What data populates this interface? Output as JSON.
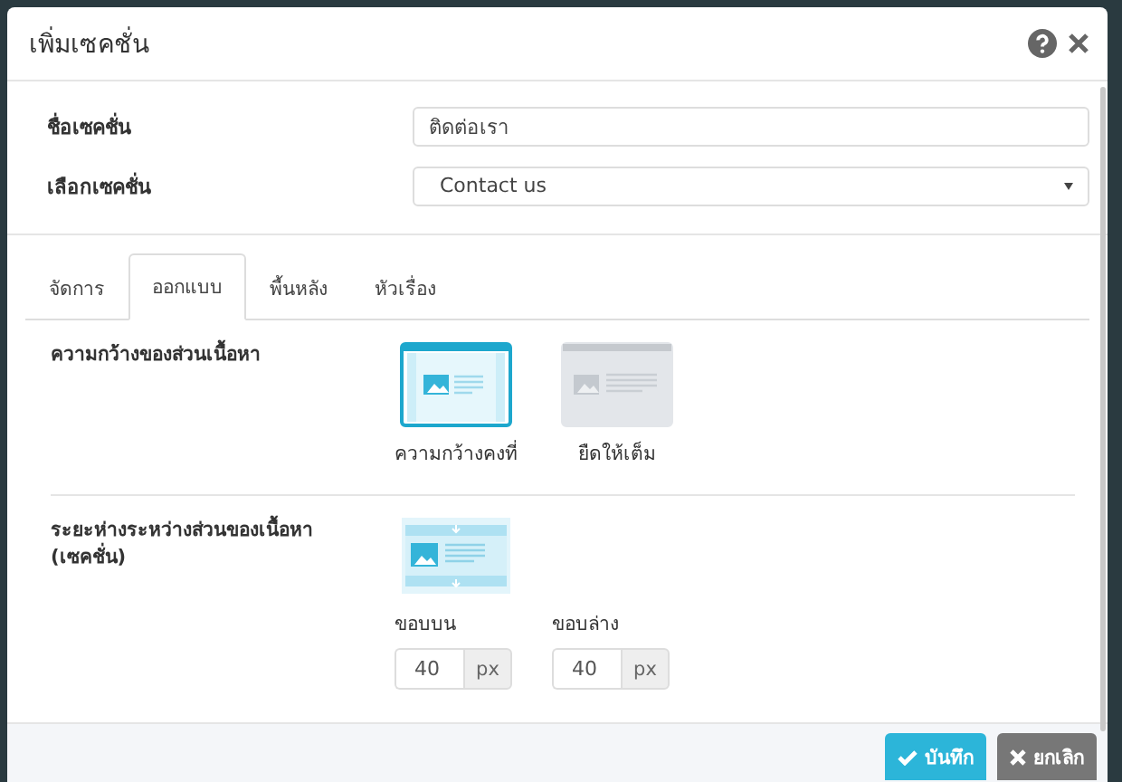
{
  "dialog": {
    "title": "เพิ่มเซคชั่น"
  },
  "fields": [
    {
      "label": "ชื่อเซคชั่น",
      "kind": "text",
      "value": "ติดต่อเรา"
    },
    {
      "label": "เลือกเซคชั่น",
      "kind": "select",
      "value": "Contact us"
    }
  ],
  "tabs": [
    {
      "label": "จัดการ",
      "selected": false
    },
    {
      "label": "ออกแบบ",
      "selected": true
    },
    {
      "label": "พื้นหลัง",
      "selected": false
    },
    {
      "label": "หัวเรื่อง",
      "selected": false
    }
  ],
  "width_section": {
    "label": "ความกว้างของส่วนเนื้อหา",
    "options": [
      {
        "label": "ความกว้างคงที่",
        "kind": "fixed",
        "selected": true
      },
      {
        "label": "ยืดให้เต็ม",
        "kind": "full",
        "selected": false
      }
    ]
  },
  "spacing_section": {
    "label": "ระยะห่างระหว่างส่วนของเนื้อหา (เซคชั่น)",
    "inputs": [
      {
        "label": "ขอบบน",
        "value": "40",
        "unit": "px"
      },
      {
        "label": "ขอบล่าง",
        "value": "40",
        "unit": "px"
      }
    ]
  },
  "buttons": [
    {
      "label": "บันทึก",
      "kind": "primary"
    },
    {
      "label": "ยกเลิก",
      "kind": "cancel"
    }
  ]
}
